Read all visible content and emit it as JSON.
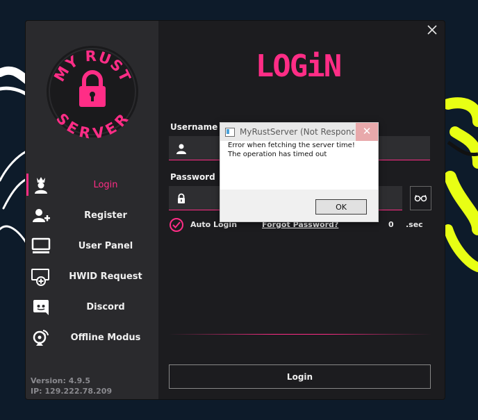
{
  "app": {
    "logo_text_top": "MY RUST",
    "logo_text_bottom": "SERVER",
    "title": "LOGiN",
    "accent_color": "#ff2d86",
    "decor_color": "#e8ff14"
  },
  "sidebar": {
    "items": [
      {
        "label": "Login",
        "icon": "crown-user-icon",
        "active": true
      },
      {
        "label": "Register",
        "icon": "add-user-icon",
        "active": false
      },
      {
        "label": "User Panel",
        "icon": "monitor-icon",
        "active": false
      },
      {
        "label": "HWID Request",
        "icon": "monitor-add-icon",
        "active": false
      },
      {
        "label": "Discord",
        "icon": "discord-icon",
        "active": false
      },
      {
        "label": "Offline Modus",
        "icon": "satellite-dish-icon",
        "active": false
      }
    ],
    "version": "Version: 4.9.5",
    "ip": "IP: 129.222.78.209"
  },
  "form": {
    "username_label": "Username",
    "username_value": "",
    "password_label": "Password",
    "password_value": "",
    "auto_login_label": "Auto Login",
    "auto_login_checked": true,
    "forgot_label": "Forgot Password?",
    "timer_value": "0",
    "timer_unit": ".sec",
    "login_button": "Login"
  },
  "dialog": {
    "title": "MyRustServer (Not Respondi...",
    "message_line1": "Error when fetching the server time!",
    "message_line2": "The operation has timed out",
    "ok_button": "OK"
  }
}
